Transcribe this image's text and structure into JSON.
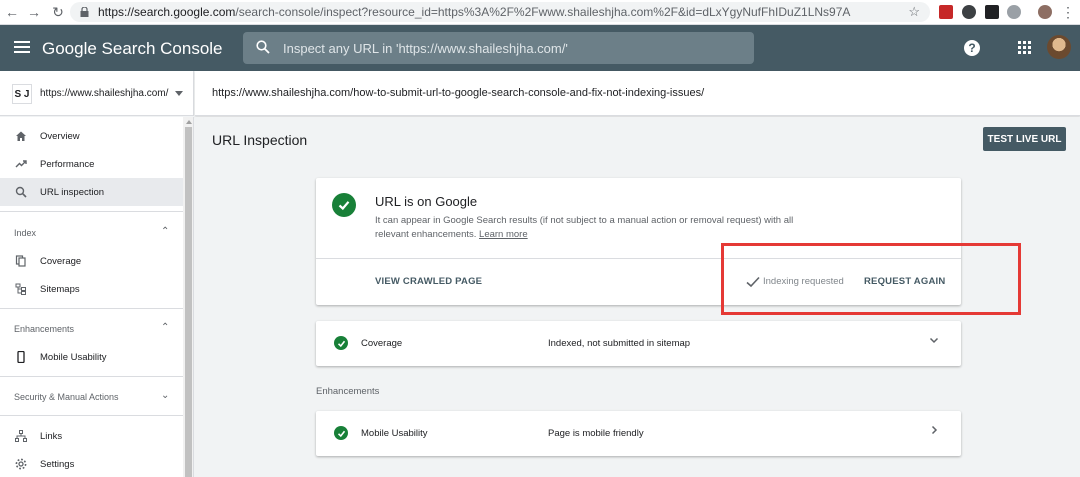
{
  "browser": {
    "url_host": "https://search.google.com",
    "url_path": "/search-console/inspect?resource_id=https%3A%2F%2Fwww.shaileshjha.com%2F&id=dLxYgyNufFhIDuZ1LNs97A"
  },
  "appbar": {
    "brand": "Google Search Console",
    "search_placeholder": "Inspect any URL in 'https://www.shaileshjha.com/'",
    "help_glyph": "?"
  },
  "property": {
    "logo": "S J",
    "url": "https://www.shaileshjha.com/"
  },
  "inspected_url": "https://www.shaileshjha.com/how-to-submit-url-to-google-search-console-and-fix-not-indexing-issues/",
  "sidebar": {
    "items_top": [
      {
        "label": "Overview",
        "icon": "home-icon"
      },
      {
        "label": "Performance",
        "icon": "trending-up-icon"
      },
      {
        "label": "URL inspection",
        "icon": "search-icon"
      }
    ],
    "index_section": "Index",
    "index_items": [
      {
        "label": "Coverage",
        "icon": "file-copy-icon"
      },
      {
        "label": "Sitemaps",
        "icon": "sitemap-icon"
      }
    ],
    "enh_section": "Enhancements",
    "enh_items": [
      {
        "label": "Mobile Usability",
        "icon": "phone-icon"
      }
    ],
    "security_section": "Security & Manual Actions",
    "bottom_items": [
      {
        "label": "Links",
        "icon": "links-icon"
      },
      {
        "label": "Settings",
        "icon": "gear-icon"
      }
    ]
  },
  "main": {
    "title": "URL Inspection",
    "test_live_label": "TEST LIVE URL",
    "status_card": {
      "title": "URL is on Google",
      "desc": "It can appear in Google Search results (if not subject to a manual action or removal request) with all relevant enhancements.",
      "learn_more": "Learn more",
      "view_crawled": "VIEW CRAWLED PAGE",
      "indexing_requested": "Indexing requested",
      "request_again": "REQUEST AGAIN"
    },
    "coverage": {
      "label": "Coverage",
      "value": "Indexed, not submitted in sitemap"
    },
    "enhancements_heading": "Enhancements",
    "mobile": {
      "label": "Mobile Usability",
      "value": "Page is mobile friendly"
    }
  },
  "colors": {
    "appbar": "#455a64",
    "success": "#188038",
    "highlight": "#e53935"
  }
}
